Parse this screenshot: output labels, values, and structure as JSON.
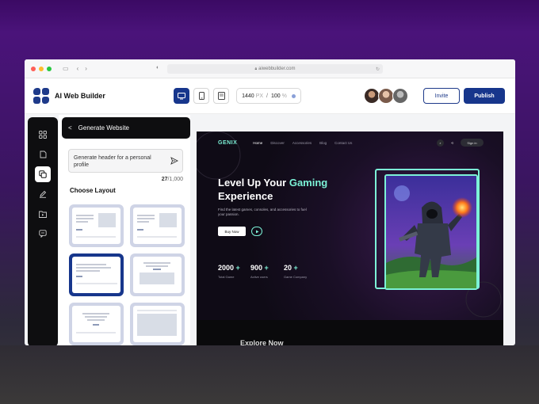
{
  "browser": {
    "url": "aiwebbuilder.com",
    "traffic_colors": [
      "#ff5f57",
      "#febc2e",
      "#28c840"
    ]
  },
  "app": {
    "brand": "AI Web Builder",
    "zoom": {
      "width": "1440",
      "unit": "PX",
      "sep": "/",
      "percent": "100",
      "pct_unit": "%"
    },
    "invite_label": "Invite",
    "publish_label": "Publish",
    "accent": "#17368c"
  },
  "sidebar": {
    "items": [
      {
        "icon": "grid-icon"
      },
      {
        "icon": "page-icon"
      },
      {
        "icon": "layers-icon",
        "active": true
      },
      {
        "icon": "edit-icon"
      },
      {
        "icon": "media-icon"
      },
      {
        "icon": "chat-icon"
      }
    ]
  },
  "panel": {
    "title": "Generate Website",
    "prompt_value": "Generate header for a personal profile",
    "counter_current": "27",
    "counter_max": "/1,000",
    "layout_heading": "Choose Layout"
  },
  "preview": {
    "brand": "GENIX",
    "nav_links": [
      "Home",
      "Discover",
      "Accessories",
      "Blog",
      "Contact Us"
    ],
    "signin_label": "Sign in",
    "headline_1": "Level Up Your ",
    "headline_accent": "Gaming",
    "headline_2": "Experience",
    "subtext": "Find the latest games, consoles, and accessories to fuel your passion.",
    "buy_label": "Buy Now",
    "stats": [
      {
        "num": "2000",
        "plus": "+",
        "label": "Total Game"
      },
      {
        "num": "900",
        "plus": "+",
        "label": "Active users"
      },
      {
        "num": "20",
        "plus": "+",
        "label": "Game Company"
      }
    ],
    "explore_label": "Explore Now",
    "accent": "#7cf2d7"
  }
}
